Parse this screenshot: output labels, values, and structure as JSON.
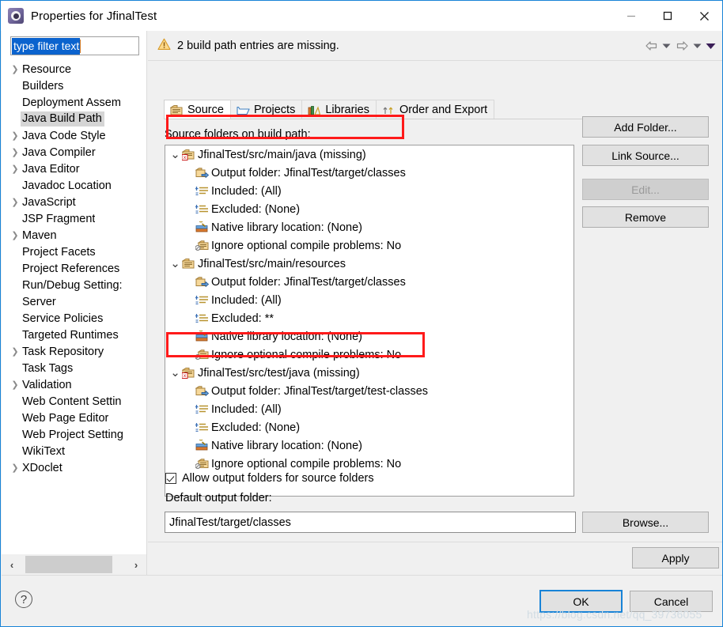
{
  "window": {
    "title": "Properties for JfinalTest",
    "icon": "properties-gear-icon",
    "minimize_label": "—",
    "maximize_label": "□",
    "close_label": "✕"
  },
  "filter": {
    "value": "type filter text",
    "placeholder": "type filter text"
  },
  "sidebar": {
    "items": [
      {
        "label": "Resource",
        "expandable": true,
        "selected": false
      },
      {
        "label": "Builders",
        "expandable": false,
        "selected": false
      },
      {
        "label": "Deployment Assem",
        "expandable": false,
        "selected": false
      },
      {
        "label": "Java Build Path",
        "expandable": false,
        "selected": true
      },
      {
        "label": "Java Code Style",
        "expandable": true,
        "selected": false
      },
      {
        "label": "Java Compiler",
        "expandable": true,
        "selected": false
      },
      {
        "label": "Java Editor",
        "expandable": true,
        "selected": false
      },
      {
        "label": "Javadoc Location",
        "expandable": false,
        "selected": false
      },
      {
        "label": "JavaScript",
        "expandable": true,
        "selected": false
      },
      {
        "label": "JSP Fragment",
        "expandable": false,
        "selected": false
      },
      {
        "label": "Maven",
        "expandable": true,
        "selected": false
      },
      {
        "label": "Project Facets",
        "expandable": false,
        "selected": false
      },
      {
        "label": "Project References",
        "expandable": false,
        "selected": false
      },
      {
        "label": "Run/Debug Setting:",
        "expandable": false,
        "selected": false
      },
      {
        "label": "Server",
        "expandable": false,
        "selected": false
      },
      {
        "label": "Service Policies",
        "expandable": false,
        "selected": false
      },
      {
        "label": "Targeted Runtimes",
        "expandable": false,
        "selected": false
      },
      {
        "label": "Task Repository",
        "expandable": true,
        "selected": false
      },
      {
        "label": "Task Tags",
        "expandable": false,
        "selected": false
      },
      {
        "label": "Validation",
        "expandable": true,
        "selected": false
      },
      {
        "label": "Web Content Settin",
        "expandable": false,
        "selected": false
      },
      {
        "label": "Web Page Editor",
        "expandable": false,
        "selected": false
      },
      {
        "label": "Web Project Setting",
        "expandable": false,
        "selected": false
      },
      {
        "label": "WikiText",
        "expandable": false,
        "selected": false
      },
      {
        "label": "XDoclet",
        "expandable": true,
        "selected": false
      }
    ]
  },
  "warning": {
    "text": "2 build path entries are missing.",
    "icon": "warning-triangle-icon"
  },
  "nav": {
    "back_icon": "back-arrow-icon",
    "back_menu_icon": "chevron-down-icon",
    "forward_icon": "forward-arrow-icon",
    "forward_menu_icon": "chevron-down-icon",
    "more_icon": "chevron-down-filled-icon"
  },
  "tabs": [
    {
      "label": "Source",
      "icon": "source-folder-icon",
      "active": true
    },
    {
      "label": "Projects",
      "icon": "open-folder-icon",
      "active": false
    },
    {
      "label": "Libraries",
      "icon": "libraries-books-icon",
      "active": false
    },
    {
      "label": "Order and Export",
      "icon": "order-export-icon",
      "active": false
    }
  ],
  "source_tab": {
    "section_label": "Source folders on build path:",
    "entries": [
      {
        "path": "JfinalTest/src/main/java (missing)",
        "icon": "source-folder-missing-icon",
        "missing": true,
        "children": [
          {
            "label": "Output folder: JfinalTest/target/classes",
            "icon": "output-folder-icon"
          },
          {
            "label": "Included: (All)",
            "icon": "include-filter-icon"
          },
          {
            "label": "Excluded: (None)",
            "icon": "exclude-filter-icon"
          },
          {
            "label": "Native library location: (None)",
            "icon": "native-library-icon"
          },
          {
            "label": "Ignore optional compile problems: No",
            "icon": "compile-problems-icon"
          }
        ]
      },
      {
        "path": "JfinalTest/src/main/resources",
        "icon": "source-folder-icon",
        "missing": false,
        "children": [
          {
            "label": "Output folder: JfinalTest/target/classes",
            "icon": "output-folder-icon"
          },
          {
            "label": "Included: (All)",
            "icon": "include-filter-icon"
          },
          {
            "label": "Excluded: **",
            "icon": "exclude-filter-icon"
          },
          {
            "label": "Native library location: (None)",
            "icon": "native-library-icon"
          },
          {
            "label": "Ignore optional compile problems: No",
            "icon": "compile-problems-icon"
          }
        ]
      },
      {
        "path": "JfinalTest/src/test/java (missing)",
        "icon": "source-folder-missing-icon",
        "missing": true,
        "children": [
          {
            "label": "Output folder: JfinalTest/target/test-classes",
            "icon": "output-folder-icon"
          },
          {
            "label": "Included: (All)",
            "icon": "include-filter-icon"
          },
          {
            "label": "Excluded: (None)",
            "icon": "exclude-filter-icon"
          },
          {
            "label": "Native library location: (None)",
            "icon": "native-library-icon"
          },
          {
            "label": "Ignore optional compile problems: No",
            "icon": "compile-problems-icon"
          }
        ]
      }
    ],
    "buttons": {
      "add_folder": "Add Folder...",
      "link_source": "Link Source...",
      "edit": "Edit...",
      "remove": "Remove",
      "browse": "Browse..."
    },
    "allow_output_folders": {
      "label": "Allow output folders for source folders",
      "checked": true
    },
    "default_output_label": "Default output folder:",
    "default_output_value": "JfinalTest/target/classes"
  },
  "footer": {
    "apply": "Apply",
    "ok": "OK",
    "cancel": "Cancel",
    "help_icon": "question-mark-icon",
    "help_label": "?"
  },
  "watermark": "https://blog.csdn.net/qq_39736055",
  "colors": {
    "accent": "#1883d7",
    "selection": "#0b63ce",
    "annotation": "#ff1a1a",
    "warning": "#e8a33d",
    "chrome": "#f0f0f0"
  }
}
